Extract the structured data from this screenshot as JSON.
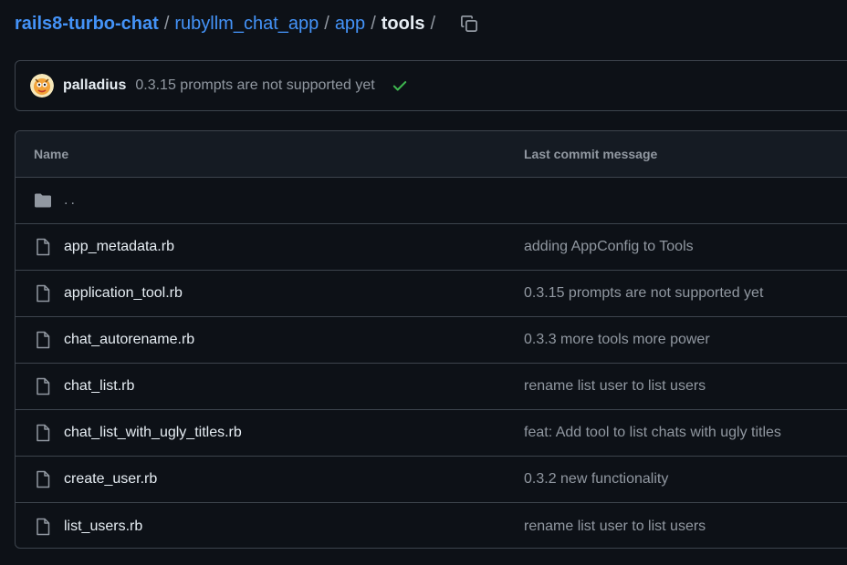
{
  "breadcrumb": {
    "repo": "rails8-turbo-chat",
    "segments": [
      "rubyllm_chat_app",
      "app"
    ],
    "current": "tools",
    "separator": "/",
    "copy_icon": "copy-icon"
  },
  "commit": {
    "author": "palladius",
    "message": "0.3.15 prompts are not supported yet",
    "status_icon": "check-icon",
    "status_color": "#3fb950"
  },
  "table": {
    "headers": {
      "name": "Name",
      "message": "Last commit message"
    },
    "parent": "..",
    "files": [
      {
        "name": "app_metadata.rb",
        "message": "adding AppConfig to Tools"
      },
      {
        "name": "application_tool.rb",
        "message": "0.3.15 prompts are not supported yet"
      },
      {
        "name": "chat_autorename.rb",
        "message": "0.3.3 more tools more power"
      },
      {
        "name": "chat_list.rb",
        "message": "rename list user to list users"
      },
      {
        "name": "chat_list_with_ugly_titles.rb",
        "message": "feat: Add tool to list chats with ugly titles"
      },
      {
        "name": "create_user.rb",
        "message": "0.3.2 new functionality"
      },
      {
        "name": "list_users.rb",
        "message": "rename list user to list users"
      }
    ]
  },
  "colors": {
    "link": "#4493f8",
    "background": "#0d1117",
    "border": "#3d444d",
    "muted": "#9198a1"
  }
}
